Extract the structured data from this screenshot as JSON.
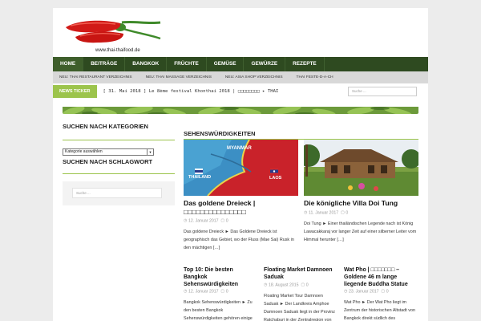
{
  "logo": {
    "text": "www.thai-thaifood.de"
  },
  "nav": {
    "items": [
      "HOME",
      "BEITRÄGE",
      "BANGKOK",
      "FRÜCHTE",
      "GEMÜSE",
      "GEWÜRZE",
      "REZEPTE"
    ]
  },
  "subnav": {
    "items": [
      "NEU: THAI RESTAURANT VERZEICHNIS",
      "NEU: THAI MASSAGE VERZEICHNIS",
      "NEU: ASIA SHOP VERZEICHNIS",
      "THAI FESTE-D-A-CH"
    ]
  },
  "ticker": {
    "label": "NEWS TICKER",
    "text": "[ 31. Mai 2018 ]  Le 8ème festival Khonthai 2018 | □□□□□□□□  ▸ THAI",
    "nav_left": "‹",
    "nav_right": "›"
  },
  "search": {
    "placeholder": "Suche ..."
  },
  "sidebar": {
    "categories_title": "SUCHEN NACH KATEGORIEN",
    "categories_select": "Kategorie auswählen",
    "tags_title": "SUCHEN NACH SCHLAGWORT",
    "tags_search_placeholder": "Suche ..."
  },
  "section": {
    "title": "SEHENSWÜRDIGKEITEN"
  },
  "featured": [
    {
      "title": "Das goldene Dreieck | □□□□□□□□□□□□□□□",
      "date": "12. Januar 2017",
      "comments": "0",
      "excerpt": "Das goldene Dreieck ► Das Goldene Dreieck ist geographisch das Gebiet, wo der Fluss (Mae Sai) Rusk in den mächtigen […]",
      "map_labels": [
        "MYANMAR",
        "THAILAND",
        "LAOS"
      ]
    },
    {
      "title": "Die königliche Villa Doi Tung",
      "date": "11. Januar 2017",
      "comments": "0",
      "excerpt": "Doi Tung ► Einer thailändischen Legende nach ist König Lawacakkaraj vor langer Zeit auf einer silberner Leiter vom Himmal herunter […]"
    }
  ],
  "posts": [
    {
      "title": "Top 10: Die besten Bangkok Sehenswürdigkeiten",
      "date": "12. Januar 2017",
      "comments": "0",
      "excerpt": "Bangkok Sehenswürdigkeiten ► Zu den besten Bangkok Sehenswürdigkeiten gehören einige spektakuläre buddhistische"
    },
    {
      "title": "Floating Market Damnoen Saduak",
      "date": "18. August 2015",
      "comments": "0",
      "excerpt": "Floating Market Tour Damnoen Saduak ► Der Landkreis Amphoe Damnoen Saduak liegt in der Provinz Ratchaburi in der Zentralregion von […]"
    },
    {
      "title": "Wat Pho | □□□□□□□ – Goldene 46 m lange liegende Buddha Statue",
      "date": "23. Januar 2017",
      "comments": "0",
      "excerpt": "Wat Pho ► Der Wat Pho liegt im Zentrum der historischen Altstadt von Bangkok direkt südlich des Königspalastes. Da sein […]"
    }
  ],
  "colors": {
    "nav_bg": "#2e4a20",
    "accent": "#9cc44c",
    "page_bg": "#ececec"
  }
}
